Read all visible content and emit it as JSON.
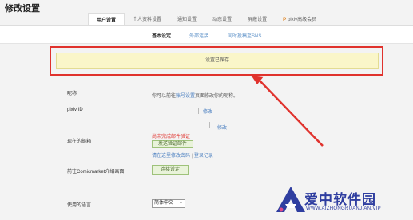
{
  "page": {
    "title": "修改设置"
  },
  "tabs": [
    {
      "label": "用户设置",
      "active": true
    },
    {
      "label": "个人资料设置"
    },
    {
      "label": "通知设置"
    },
    {
      "label": "动态设置"
    },
    {
      "label": "屏蔽设置"
    },
    {
      "label": "pixiv高级会员",
      "prefix": "P"
    }
  ],
  "subnav": [
    {
      "label": "基本设定"
    },
    {
      "label": "外部连接"
    },
    {
      "label": "同时投稿至SNS"
    }
  ],
  "notice": {
    "text": "设置已保存"
  },
  "form": {
    "nickname": {
      "label": "昵称",
      "hint_pre": "你可以前往",
      "hint_link": "账号设置",
      "hint_post": "页面修改你的昵称。"
    },
    "pixiv_id": {
      "label": "pixiv ID",
      "edit": "修改"
    },
    "email": {
      "label": "现在的邮箱",
      "edit": "修改",
      "warning": "尚未完成邮件验证",
      "resend_button": "发送验证邮件",
      "links": [
        "请在这里修改密码",
        "登录记录"
      ]
    },
    "comicmarket": {
      "label": "前往Comicmarket介绍画面",
      "button": "连接设定"
    },
    "language": {
      "label": "使用的语言",
      "selected": "简体中文"
    }
  },
  "watermark": {
    "text": "爱中软件园",
    "url": "WWW.AIZHONGRUANJIAN.VIP"
  },
  "colors": {
    "highlight_border": "#e0322d",
    "notice_bg": "#faf6c9",
    "link": "#4a7fc0",
    "brand_blue": "#2f3ea0"
  }
}
